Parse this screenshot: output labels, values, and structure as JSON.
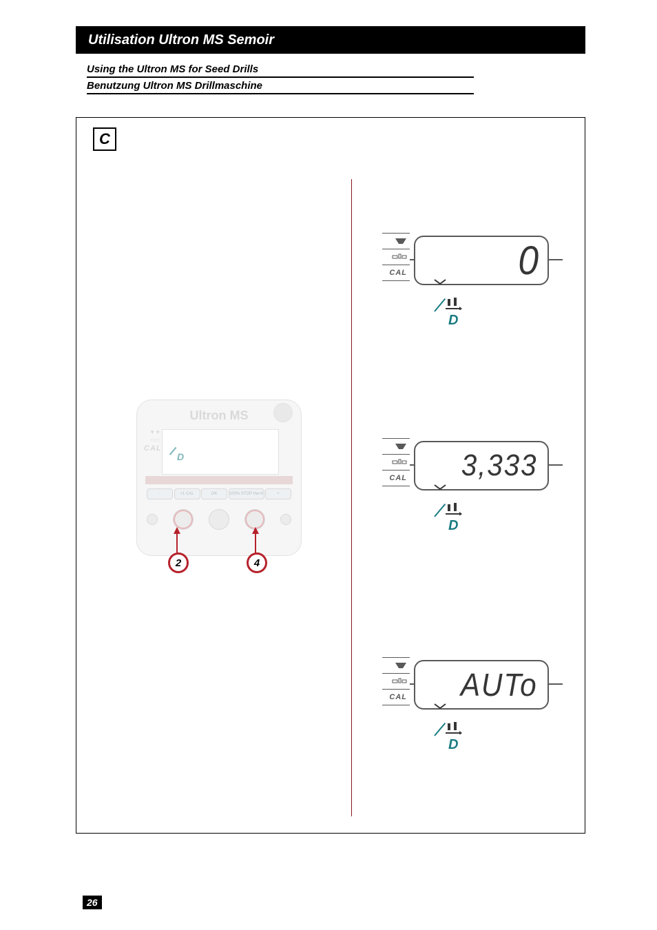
{
  "header": {
    "title_fr": "Utilisation Ultron MS Semoir"
  },
  "subheaders": {
    "en": "Using the Ultron MS for Seed Drills",
    "de": "Benutzung Ultron MS Drillmaschine"
  },
  "frame": {
    "label": "C"
  },
  "device": {
    "brand": "Ultron MS",
    "side_labels": [
      "▼▼",
      "▭▭",
      "CAL"
    ],
    "d_label": "D",
    "button_labels": [
      "-",
      "+1 CAL",
      "OK",
      "100%  STOP Ha=0",
      "+"
    ],
    "callouts": [
      "2",
      "4"
    ]
  },
  "lcd": {
    "side": {
      "cal": "CAL"
    },
    "screens": [
      {
        "value": "0",
        "d": "D"
      },
      {
        "value": "3,333",
        "d": "D"
      },
      {
        "value": "AUTo",
        "d": "D"
      }
    ]
  },
  "page_number": "26"
}
